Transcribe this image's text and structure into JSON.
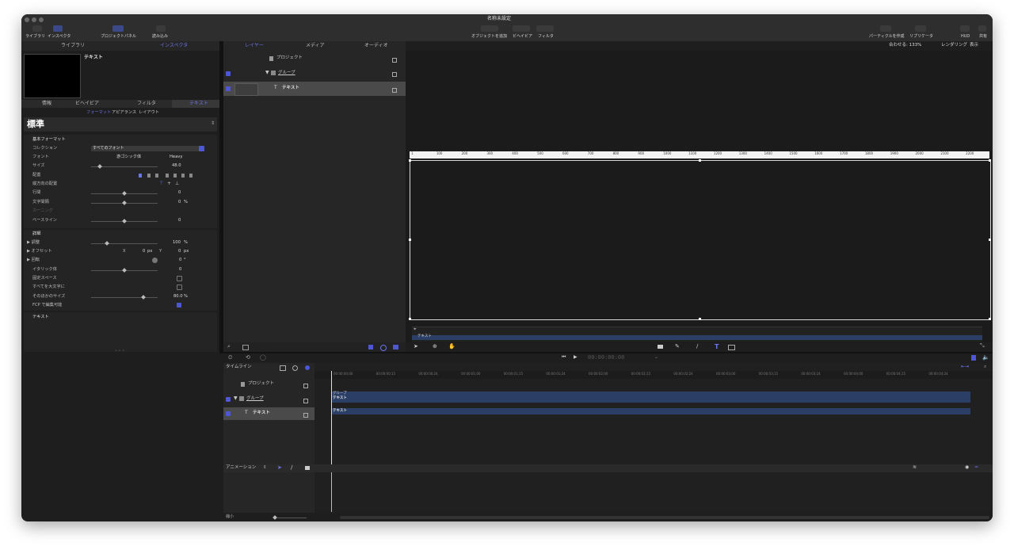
{
  "window": {
    "title": "名称未設定"
  },
  "toolbar": {
    "library": "ライブラリ",
    "inspector": "インスペクタ",
    "project_panel": "プロジェクトパネル",
    "import": "読み込み",
    "add_object": "オブジェクトを追加",
    "behaviors": "ビヘイビア",
    "filters": "フィルタ",
    "make_particles": "パーティクルを作成",
    "replicator": "リプリケータ",
    "hud": "HUD",
    "share": "共有"
  },
  "left_panel": {
    "tabs": [
      "ライブラリ",
      "インスペクタ"
    ],
    "active_tab": "インスペクタ",
    "preview_title": "テキスト",
    "inspector_tabs": [
      "情報",
      "ビヘイビア",
      "フィルタ",
      "テキスト"
    ],
    "sub_tabs": [
      "フォーマット",
      "アピアランス",
      "レイアウト"
    ],
    "preset": "標準",
    "basic_format": {
      "header": "基本フォーマット",
      "collection_label": "コレクション",
      "collection_value": "すべてのフォント",
      "font_label": "フォント",
      "font_value": "游ゴシック体",
      "font_weight": "Heavy",
      "size_label": "サイズ",
      "size_value": "48.0",
      "alignment_label": "配置",
      "vertical_alignment_label": "縦方向の配置",
      "line_spacing_label": "行間",
      "line_spacing_value": "0",
      "tracking_label": "文字間隔",
      "tracking_value": "0",
      "tracking_unit": "%",
      "kerning_label": "カーニング",
      "baseline_label": "ベースライン",
      "baseline_value": "0"
    },
    "details": {
      "header": "詳細",
      "scale_label": "▶ 調整",
      "scale_value": "100",
      "scale_unit": "%",
      "offset_label": "▶ オフセット",
      "offset_x_label": "X",
      "offset_x_value": "0",
      "offset_x_unit": "px",
      "offset_y_label": "Y",
      "offset_y_value": "0",
      "offset_y_unit": "px",
      "rotation_label": "▶ 回転",
      "rotation_value": "0",
      "rotation_unit": "°",
      "slant_label": "イタリック体",
      "slant_value": "0",
      "monospace_label": "固定スペース",
      "all_caps_label": "すべてを大文字に",
      "all_caps_size_label": "そのほかのサイズ",
      "all_caps_size_value": "80.0",
      "all_caps_size_unit": "%",
      "fcp_label": "FCP で編集可能"
    },
    "text_section": "テキスト"
  },
  "layers_panel": {
    "tabs": [
      "レイヤー",
      "メディア",
      "オーディオ"
    ],
    "active_tab": "レイヤー",
    "items": [
      {
        "name": "プロジェクト"
      },
      {
        "name": "グループ"
      },
      {
        "name": "テキスト"
      }
    ]
  },
  "canvas": {
    "fit_label": "合わせる: 133%",
    "rendering": "レンダリング",
    "view": "表示",
    "ruler_labels": [
      "1",
      "100",
      "200",
      "300",
      "400",
      "500",
      "600",
      "700",
      "800",
      "900",
      "1000",
      "1100",
      "1200",
      "1300",
      "1400",
      "1500",
      "1600",
      "1700",
      "1800",
      "1900",
      "2000",
      "2100",
      "2200"
    ],
    "mini_label": "テキスト"
  },
  "transport": {
    "timecode": "00:00:00:00"
  },
  "timeline": {
    "label": "タイムライン",
    "ticks": [
      "00:00:00;00",
      "00:00:00;15",
      "00:00:00;24",
      "00:00:01;00",
      "00:00:01;15",
      "00:00:01;24",
      "00:00:02;00",
      "00:00:02;15",
      "00:00:02;24",
      "00:00:03;00",
      "00:00:03;15",
      "00:00:03;24",
      "00:00:04;00",
      "00:00:04;15",
      "00:00:04;24"
    ],
    "tracks": [
      {
        "name": "プロジェクト"
      },
      {
        "name": "グループ"
      },
      {
        "name": "テキスト"
      }
    ],
    "bars": [
      {
        "label": "グループ",
        "sub": "テキスト"
      },
      {
        "label": "テキスト"
      }
    ]
  },
  "animation": {
    "label": "アニメーション",
    "zoom_label": "縮小"
  },
  "colors": {
    "accent": "#6b74e8",
    "bar": "#2b3f66",
    "bg": "#1e1e1e"
  }
}
